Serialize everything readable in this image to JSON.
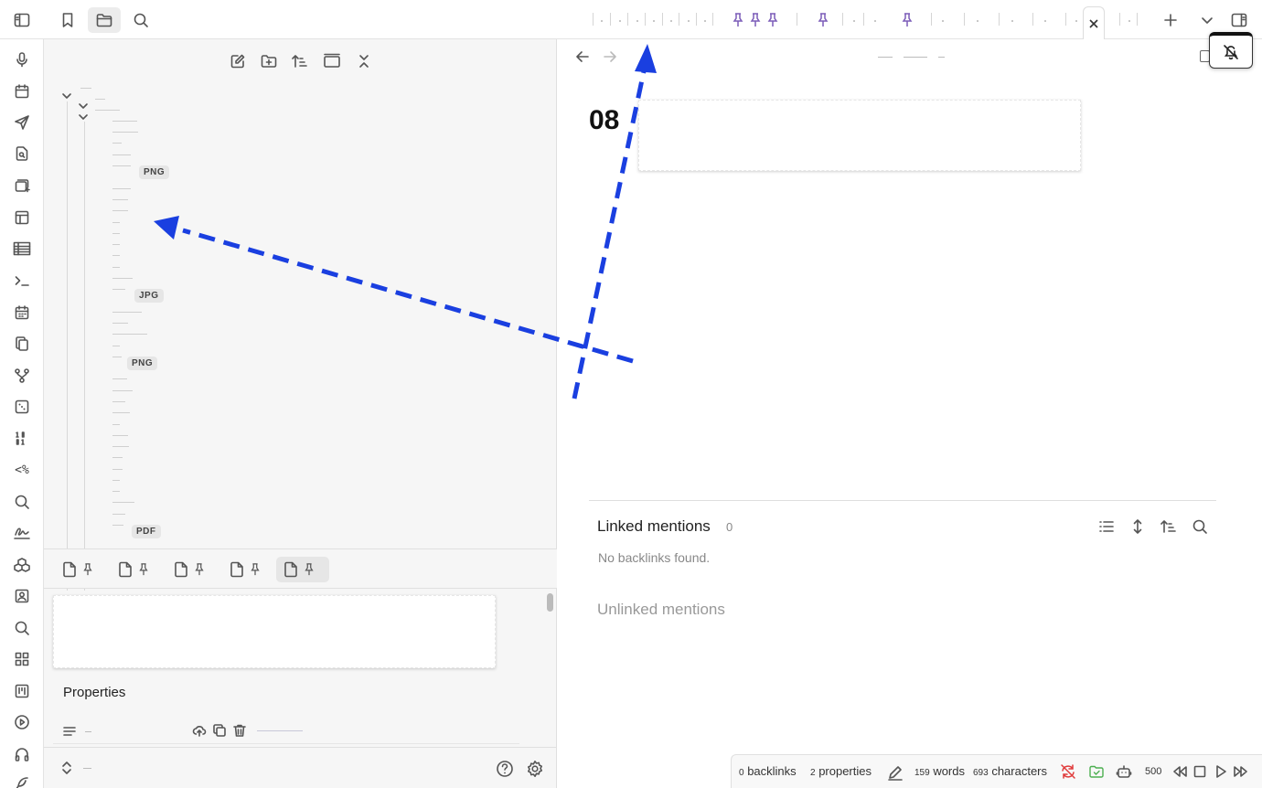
{
  "sidebar": {
    "tree_badges": [
      "PNG",
      "JPG",
      "PNG",
      "PDF"
    ],
    "properties_title": "Properties"
  },
  "main": {
    "title_prefix": "08",
    "linked_mentions": {
      "title": "Linked mentions",
      "count": "0",
      "empty_text": "No backlinks found."
    },
    "unlinked_mentions": {
      "title": "Unlinked mentions"
    }
  },
  "statusbar": {
    "backlinks_count": "0",
    "backlinks_label": "backlinks",
    "properties_count": "2",
    "properties_label": "properties",
    "words_count": "159",
    "words_label": "words",
    "chars_count": "693",
    "chars_label": "characters",
    "counter": "500"
  },
  "colors": {
    "accent": "#7b5cb8",
    "arrow": "#1a3fe0",
    "sync_error": "#e03a3a",
    "sync_ok": "#4caf50"
  },
  "icons": [
    "sidebar-toggle-icon",
    "bookmark-icon",
    "folder-icon",
    "search-icon",
    "microphone-icon",
    "calendar-icon",
    "send-icon",
    "file-search-icon",
    "canvas-plus-icon",
    "layout-icon",
    "table-icon",
    "terminal-icon",
    "calendar-days-icon",
    "copy-icon",
    "git-branch-icon",
    "dice-icon",
    "binary-icon",
    "percent-icon",
    "magnifier-icon",
    "signature-icon",
    "blocks-icon",
    "contact-icon",
    "zoom-icon",
    "grid-icon",
    "kanban-icon",
    "play-circle-icon",
    "headphones-icon",
    "feather-icon"
  ]
}
